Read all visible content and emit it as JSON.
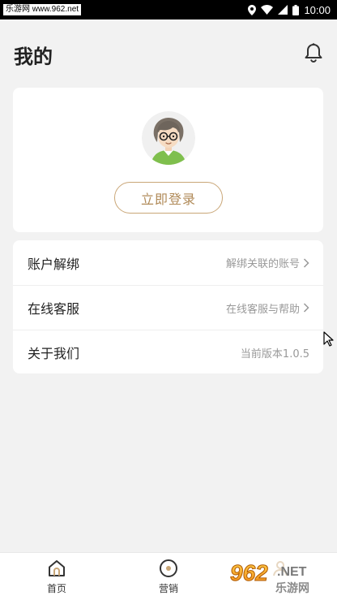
{
  "status_bar": {
    "watermark": "乐游网 www.962.net",
    "time": "10:00",
    "icons": [
      "location-icon",
      "wifi-icon",
      "cellular-signal-icon",
      "battery-icon"
    ]
  },
  "header": {
    "title": "我的",
    "notification_icon": "bell-icon"
  },
  "profile": {
    "avatar_icon": "cartoon-avatar",
    "login_label": "立即登录"
  },
  "menu": [
    {
      "label": "账户解绑",
      "value": "解绑关联的账号",
      "chevron": true
    },
    {
      "label": "在线客服",
      "value": "在线客服与帮助",
      "chevron": true
    },
    {
      "label": "关于我们",
      "value": "当前版本1.0.5",
      "chevron": false
    }
  ],
  "bottom_nav": [
    {
      "label": "首页",
      "icon": "home-icon"
    },
    {
      "label": "营销",
      "icon": "target-icon"
    },
    {
      "label": "",
      "icon": "profile-icon"
    }
  ],
  "site_watermark": "962.NET 乐游网",
  "colors": {
    "accent": "#c9a677",
    "accent_text": "#b08a58",
    "background": "#f2f2f2",
    "card": "#ffffff",
    "muted_text": "#999999"
  }
}
